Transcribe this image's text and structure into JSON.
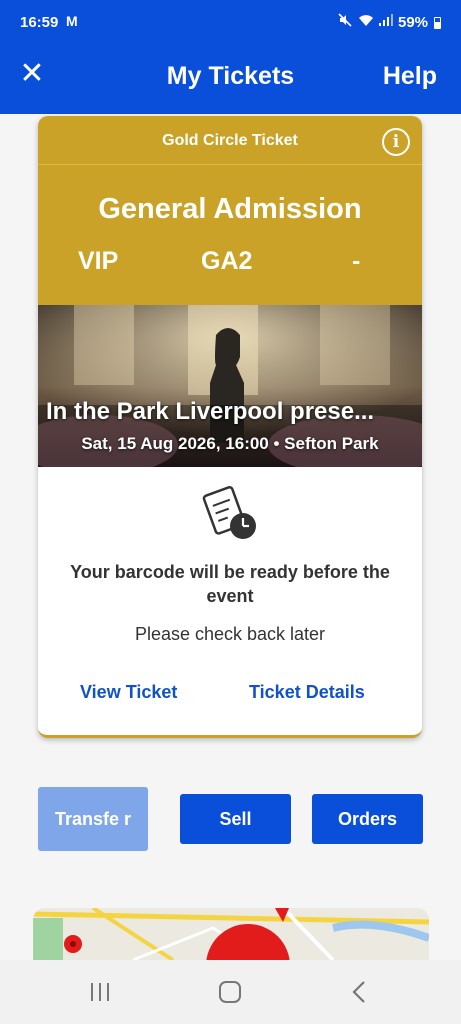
{
  "status_bar": {
    "time": "16:59",
    "mail_glyph": "M",
    "battery": "59%",
    "icons": [
      "mail-icon",
      "mute-icon",
      "wifi-icon",
      "signal-icon",
      "battery-icon"
    ]
  },
  "header": {
    "title": "My Tickets",
    "close_glyph": "✕",
    "help_label": "Help"
  },
  "ticket": {
    "type_label": "Gold Circle Ticket",
    "info_glyph": "i",
    "admission": "General Admission",
    "section": "VIP",
    "row": "GA2",
    "seat": "-",
    "event_title": "In the Park Liverpool prese...",
    "event_meta": "Sat, 15 Aug 2026, 16:00 • Sefton Park",
    "barcode_message": "Your barcode will be ready before the event",
    "check_back": "Please check back later",
    "view_ticket_label": "View Ticket",
    "ticket_details_label": "Ticket Details"
  },
  "actions": {
    "transfer_label": "Transfe r",
    "sell_label": "Sell",
    "orders_label": "Orders"
  },
  "colors": {
    "brand_blue": "#0a4fd9",
    "gold": "#c9a227",
    "link_blue": "#1252c9",
    "disabled_blue": "#7ea6e8"
  }
}
